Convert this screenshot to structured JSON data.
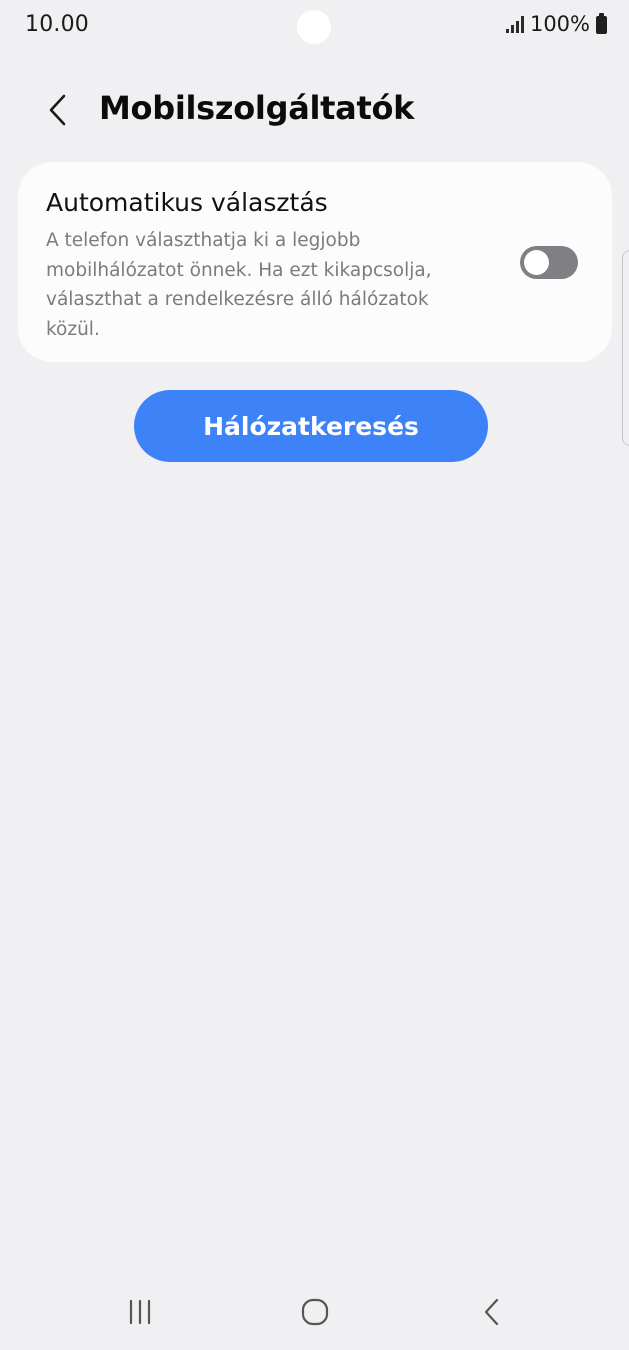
{
  "status_bar": {
    "time": "10.00",
    "battery_percent": "100%",
    "icons": [
      "signal-icon",
      "battery-icon"
    ]
  },
  "header": {
    "back_icon": "chevron-left-icon",
    "title": "Mobilszolgáltatók"
  },
  "settings": {
    "auto_select": {
      "title": "Automatikus választás",
      "description": "A telefon választhatja ki a legjobb mobilhálózatot önnek. Ha ezt kikapcsolja, választhat a rendelkezésre álló hálózatok közül.",
      "enabled": false
    }
  },
  "actions": {
    "search_networks_label": "Hálózatkeresés"
  },
  "nav_bar": {
    "icons": [
      "recents-icon",
      "home-icon",
      "back-icon"
    ]
  },
  "colors": {
    "background": "#f0f0f3",
    "card": "#fcfcfd",
    "accent": "#3e82f7",
    "toggle_off": "#7f7f84",
    "secondary_text": "#7b7b7f"
  }
}
